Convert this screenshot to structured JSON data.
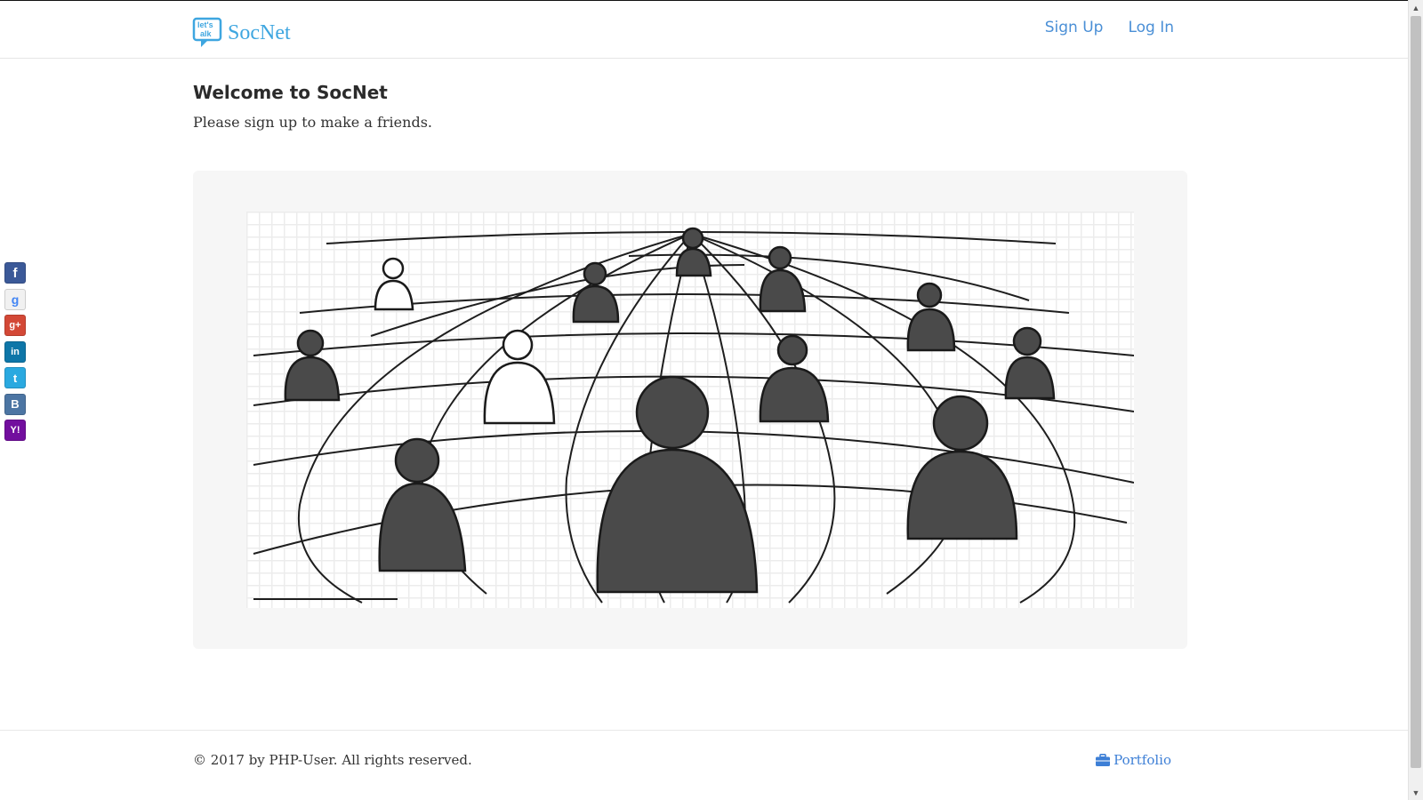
{
  "header": {
    "logo_text": "let's talk",
    "brand": "SocNet",
    "links": [
      {
        "label": "Sign Up"
      },
      {
        "label": "Log In"
      }
    ]
  },
  "main": {
    "title": "Welcome to SocNet",
    "subtitle": "Please sign up to make a friends."
  },
  "social": [
    {
      "icon": "facebook-icon",
      "glyph": "f",
      "color": "#3b5998"
    },
    {
      "icon": "google-icon",
      "glyph": "g",
      "color": "#e6e6e6"
    },
    {
      "icon": "google-plus-icon",
      "glyph": "g+",
      "color": "#d34836"
    },
    {
      "icon": "linkedin-icon",
      "glyph": "in",
      "color": "#0e76a8"
    },
    {
      "icon": "twitter-icon",
      "glyph": "t",
      "color": "#2aa9e0"
    },
    {
      "icon": "vk-icon",
      "glyph": "B",
      "color": "#4c75a3"
    },
    {
      "icon": "yahoo-icon",
      "glyph": "Y!",
      "color": "#720e9e"
    }
  ],
  "footer": {
    "copyright": "© 2017 by PHP-User. All rights reserved.",
    "portfolio_label": "Portfolio"
  },
  "colors": {
    "brand": "#3ea6e0",
    "link": "#4a8fd6"
  }
}
